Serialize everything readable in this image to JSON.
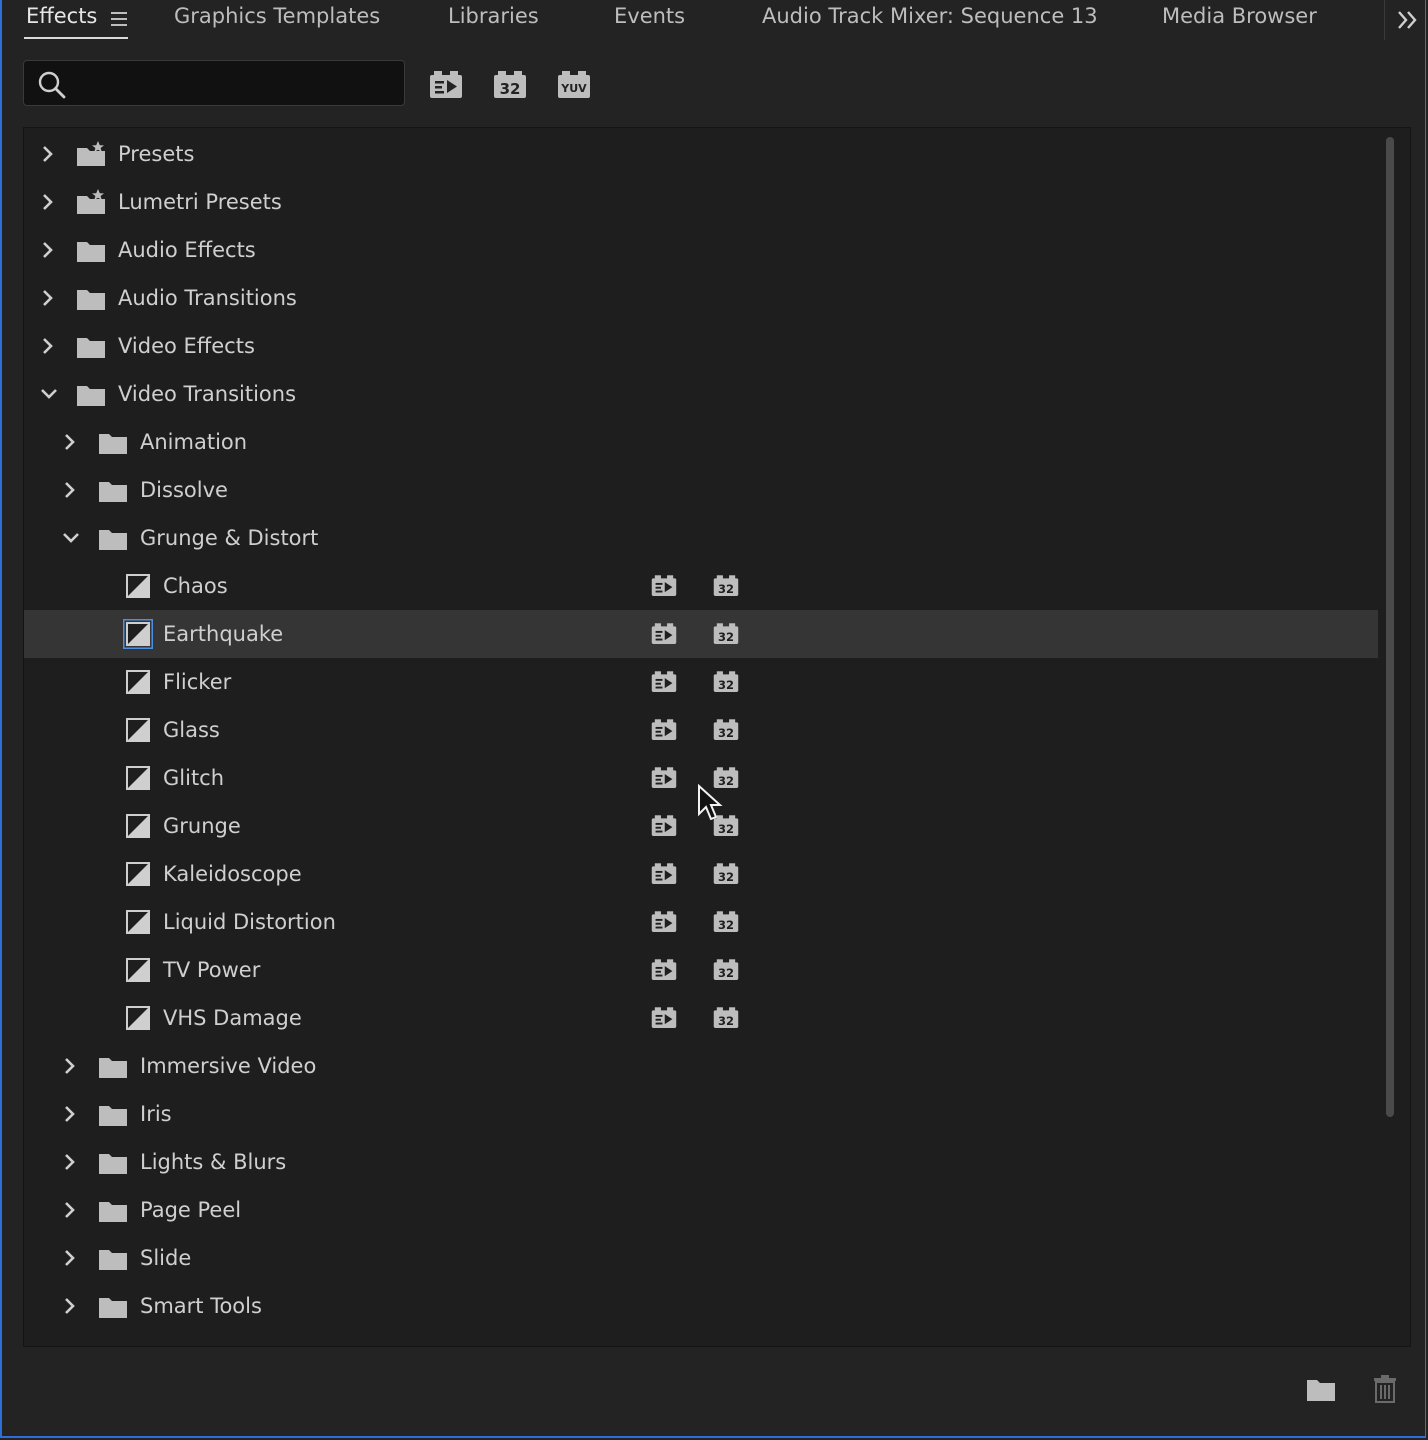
{
  "tabs": [
    {
      "label": "Effects",
      "active": true
    },
    {
      "label": "Graphics Templates"
    },
    {
      "label": "Libraries"
    },
    {
      "label": "Events"
    },
    {
      "label": "Audio Track Mixer: Sequence 13"
    },
    {
      "label": "Media Browser"
    }
  ],
  "search": {
    "placeholder": "",
    "value": ""
  },
  "filters": [
    {
      "name": "accelerated-effects-icon"
    },
    {
      "name": "32-bit-color-icon",
      "text": "32"
    },
    {
      "name": "yuv-effects-icon",
      "text": "YUV"
    }
  ],
  "tree": [
    {
      "label": "Presets",
      "level": 0,
      "type": "preset-folder",
      "expanded": false
    },
    {
      "label": "Lumetri Presets",
      "level": 0,
      "type": "preset-folder",
      "expanded": false
    },
    {
      "label": "Audio Effects",
      "level": 0,
      "type": "folder",
      "expanded": false
    },
    {
      "label": "Audio Transitions",
      "level": 0,
      "type": "folder",
      "expanded": false
    },
    {
      "label": "Video Effects",
      "level": 0,
      "type": "folder",
      "expanded": false
    },
    {
      "label": "Video Transitions",
      "level": 0,
      "type": "folder",
      "expanded": true
    },
    {
      "label": "Animation",
      "level": 1,
      "type": "folder",
      "expanded": false
    },
    {
      "label": "Dissolve",
      "level": 1,
      "type": "folder",
      "expanded": false
    },
    {
      "label": "Grunge & Distort",
      "level": 1,
      "type": "folder",
      "expanded": true
    },
    {
      "label": "Chaos",
      "level": 2,
      "type": "transition",
      "badges": true
    },
    {
      "label": "Earthquake",
      "level": 2,
      "type": "transition",
      "badges": true,
      "selected": true
    },
    {
      "label": "Flicker",
      "level": 2,
      "type": "transition",
      "badges": true
    },
    {
      "label": "Glass",
      "level": 2,
      "type": "transition",
      "badges": true
    },
    {
      "label": "Glitch",
      "level": 2,
      "type": "transition",
      "badges": true
    },
    {
      "label": "Grunge",
      "level": 2,
      "type": "transition",
      "badges": true
    },
    {
      "label": "Kaleidoscope",
      "level": 2,
      "type": "transition",
      "badges": true
    },
    {
      "label": "Liquid Distortion",
      "level": 2,
      "type": "transition",
      "badges": true
    },
    {
      "label": "TV Power",
      "level": 2,
      "type": "transition",
      "badges": true
    },
    {
      "label": "VHS Damage",
      "level": 2,
      "type": "transition",
      "badges": true
    },
    {
      "label": "Immersive Video",
      "level": 1,
      "type": "folder",
      "expanded": false
    },
    {
      "label": "Iris",
      "level": 1,
      "type": "folder",
      "expanded": false
    },
    {
      "label": "Lights & Blurs",
      "level": 1,
      "type": "folder",
      "expanded": false
    },
    {
      "label": "Page Peel",
      "level": 1,
      "type": "folder",
      "expanded": false
    },
    {
      "label": "Slide",
      "level": 1,
      "type": "folder",
      "expanded": false
    },
    {
      "label": "Smart Tools",
      "level": 1,
      "type": "folder",
      "expanded": false
    }
  ],
  "badge_text": "32",
  "footer": {
    "new_bin_icon": "folder-icon",
    "delete_icon": "trash-icon"
  },
  "colors": {
    "background": "#232323",
    "panel": "#1e1e1e",
    "selected_row": "#353535",
    "focus_border": "#2d6fd6"
  }
}
